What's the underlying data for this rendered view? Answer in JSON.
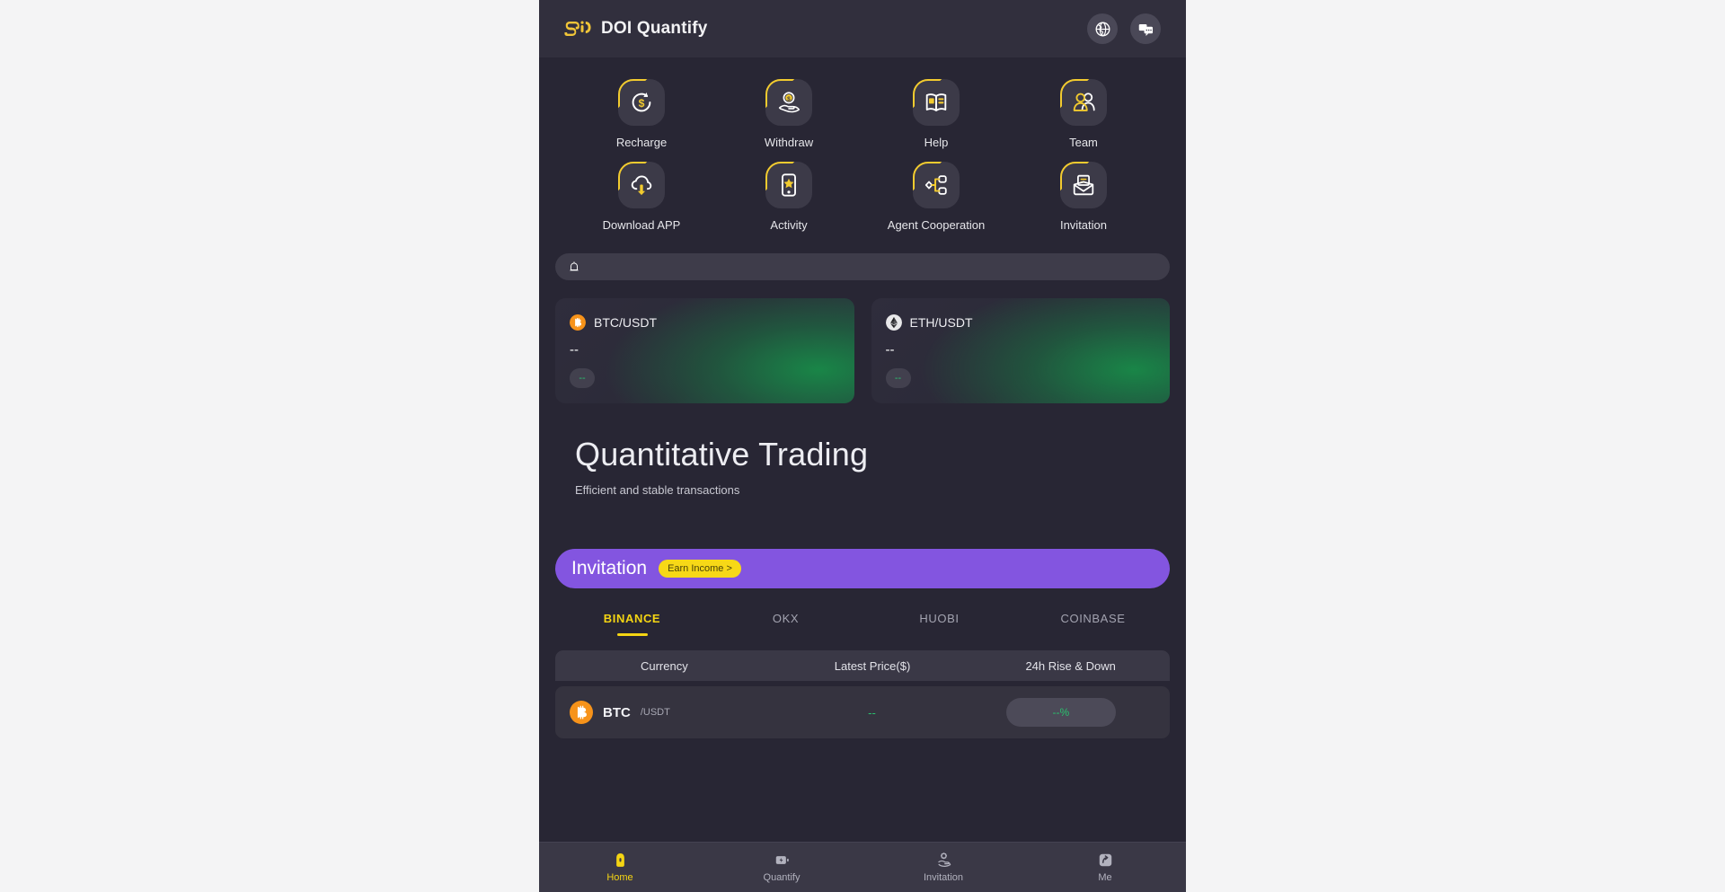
{
  "header": {
    "brand_name": "DOI Quantify",
    "logo_icon": "doi-logo",
    "actions": [
      {
        "icon": "globe-language-icon",
        "name": "language-button"
      },
      {
        "icon": "chat-support-icon",
        "name": "support-button"
      }
    ]
  },
  "quick_actions": [
    {
      "label": "Recharge",
      "icon": "recharge-icon"
    },
    {
      "label": "Withdraw",
      "icon": "withdraw-icon"
    },
    {
      "label": "Help",
      "icon": "help-book-icon"
    },
    {
      "label": "Team",
      "icon": "team-icon"
    },
    {
      "label": "Download APP",
      "icon": "download-cloud-icon"
    },
    {
      "label": "Activity",
      "icon": "activity-star-icon"
    },
    {
      "label": "Agent Cooperation",
      "icon": "agent-network-icon"
    },
    {
      "label": "Invitation",
      "icon": "invitation-mail-icon"
    }
  ],
  "notice": {
    "icon": "bell-icon",
    "text": ""
  },
  "price_cards": [
    {
      "pair": "BTC/USDT",
      "price": "--",
      "change": "--",
      "coin": "btc",
      "coin_color": "#f7931a"
    },
    {
      "pair": "ETH/USDT",
      "price": "--",
      "change": "--",
      "coin": "eth",
      "coin_color": "#e8e8ea"
    }
  ],
  "hero": {
    "title": "Quantitative Trading",
    "subtitle": "Efficient and stable transactions"
  },
  "invite_banner": {
    "title": "Invitation",
    "pill_label": "Earn Income >",
    "bg_color": "#8355e0",
    "pill_color": "#f7d817"
  },
  "exchange_tabs": [
    {
      "label": "BINANCE",
      "active": true
    },
    {
      "label": "OKX",
      "active": false
    },
    {
      "label": "HUOBI",
      "active": false
    },
    {
      "label": "COINBASE",
      "active": false
    }
  ],
  "market": {
    "columns": [
      "Currency",
      "Latest Price($)",
      "24h Rise & Down"
    ],
    "rows": [
      {
        "symbol": "BTC",
        "quote": "/USDT",
        "price": "--",
        "change": "--%",
        "coin_color": "#f7931a"
      }
    ]
  },
  "bottom_nav": [
    {
      "label": "Home",
      "icon": "home-icon",
      "active": true
    },
    {
      "label": "Quantify",
      "icon": "quantify-icon",
      "active": false
    },
    {
      "label": "Invitation",
      "icon": "invitation-icon",
      "active": false
    },
    {
      "label": "Me",
      "icon": "profile-icon",
      "active": false
    }
  ],
  "theme": {
    "page_bg": "#282634",
    "header_bg": "#312f3d",
    "accent_yellow": "#f5d513",
    "accent_purple": "#8355e0",
    "accent_green": "#29c16e"
  }
}
